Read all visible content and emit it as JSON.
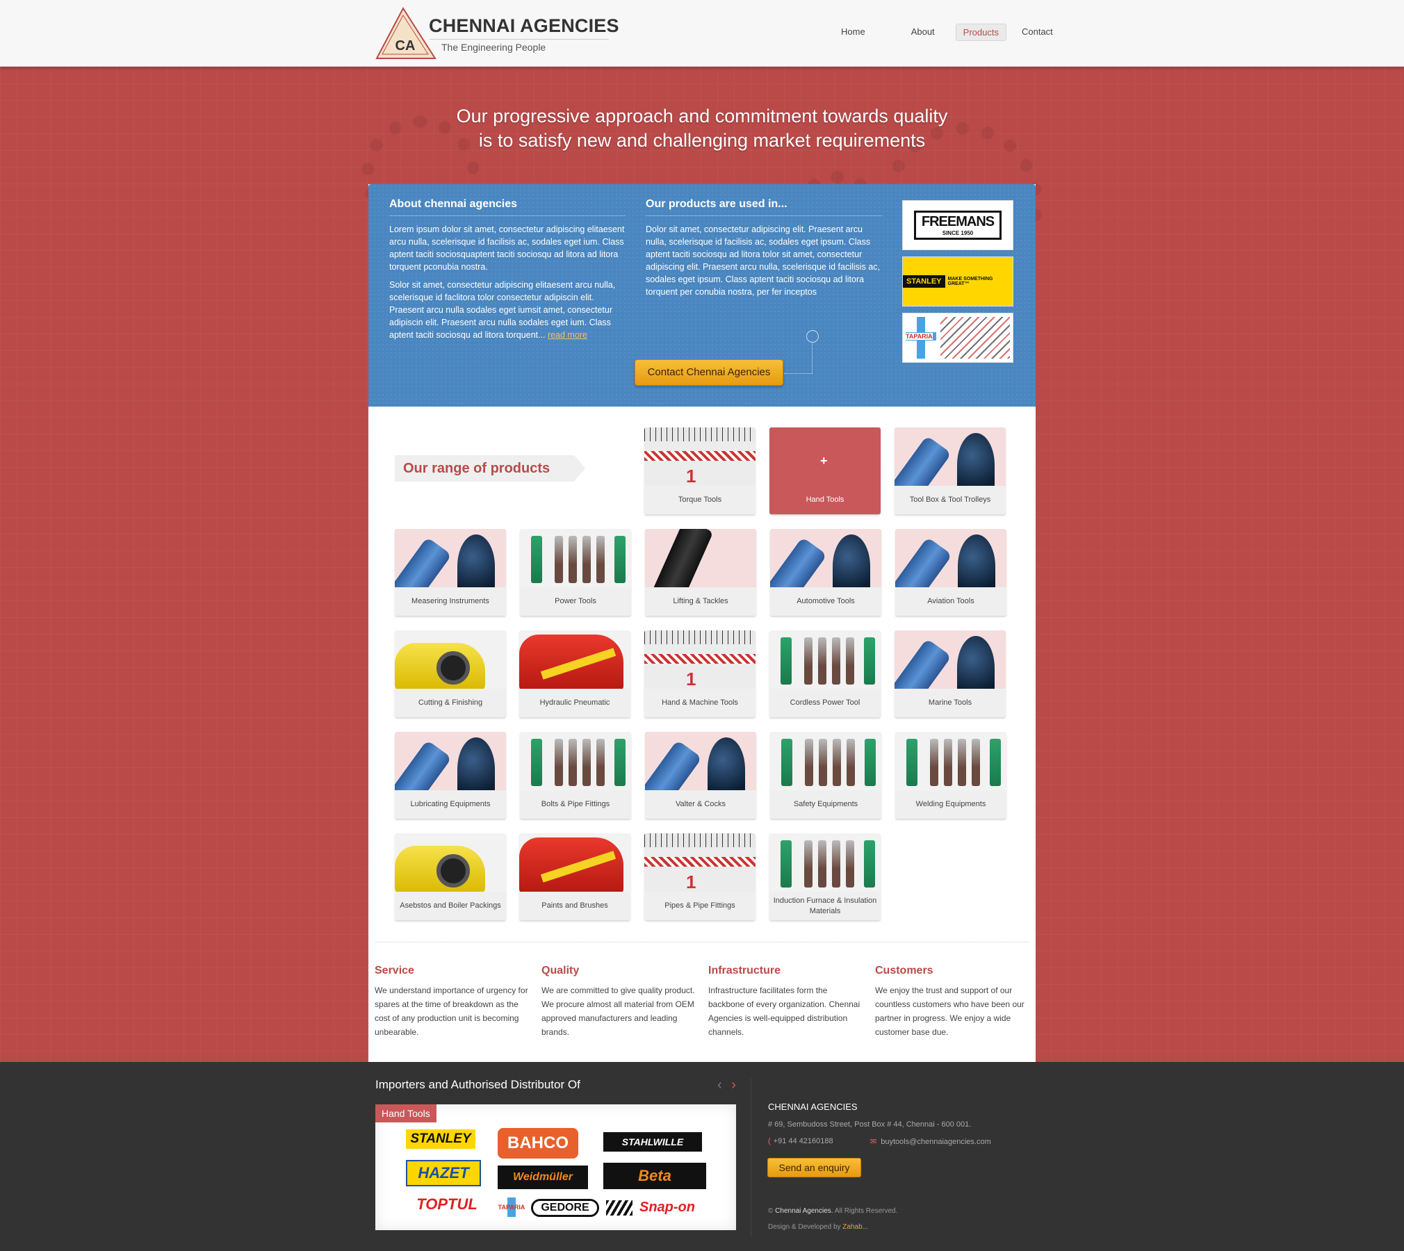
{
  "brand": {
    "name": "CHENNAI AGENCIES",
    "tagline": "The Engineering People",
    "initials": "CA"
  },
  "nav": [
    "Home",
    "About",
    "Products",
    "Contact"
  ],
  "hero": {
    "line1": "Our progressive approach and commitment towards quality",
    "line2": "is to satisfy new and challenging market requirements"
  },
  "about": {
    "title": "About chennai agencies",
    "p1": "Lorem ipsum dolor sit amet, consectetur adipiscing elitaesent arcu nulla, scelerisque id facilisis ac, sodales eget ium. Class aptent taciti sociosquaptent taciti sociosqu ad litora  ad litora torquent pconubia nostra.",
    "p2": "Solor sit amet, consectetur adipiscing elitaesent arcu nulla, scelerisque id faclitora tolor  consectetur adipiscin elit. Praesent arcu nulla sodales eget iumsit amet, consectetur adipiscin elit. Praesent arcu nulla sodales eget ium. Class aptent taciti sociosqu ad litora torquent...",
    "read_more": "read more"
  },
  "used_in": {
    "title": "Our products are used in...",
    "p": "Dolor sit amet, consectetur adipiscing elit. Praesent arcu nulla, scelerisque id facilisis ac, sodales eget ipsum. Class aptent taciti sociosqu ad litora tolor sit amet, consectetur adipiscing elit. Praesent arcu nulla, scelerisque id facilisis ac, sodales eget ipsum. Class aptent taciti sociosqu ad litora torquent per conubia nostra, per fer inceptos"
  },
  "brand_logos": {
    "freemans": "FREEMANS",
    "freemans_since": "SINCE 1950",
    "stanley": "STANLEY",
    "stanley_tag": "MAKE SOMETHING GREAT™",
    "taparia": "TAPARIA"
  },
  "contact_button": "Contact Chennai Agencies",
  "range_title": "Our range of products",
  "products": [
    "Torque Tools",
    "Hand Tools",
    "Tool Box & Tool Trolleys",
    "Measering Instruments",
    "Power Tools",
    "Lifting & Tackles",
    "Automotive Tools",
    "Aviation Tools",
    "Cutting & Finishing",
    "Hydraulic Pneumatic",
    "Hand & Machine Tools",
    "Cordless Power Tool",
    "Marine Tools",
    "Lubricating Equipments",
    "Bolts & Pipe Fittings",
    "Valter & Cocks",
    "Safety Equipments",
    "Welding Equipments",
    "Asebstos and Boiler Packings",
    "Paints and Brushes",
    "Pipes & Pipe Fittings",
    "Induction Furnace & Insulation Materials"
  ],
  "hover_plus": "+",
  "features": [
    {
      "title": "Service",
      "text": "We understand importance of urgency for spares at the time of breakdown as the cost of any production unit is becoming unbearable."
    },
    {
      "title": "Quality",
      "text": "We are committed to give quality product. We procure almost all material from OEM approved manufacturers and leading brands."
    },
    {
      "title": "Infrastructure",
      "text": "Infrastructure facilitates form the backbone of every organization. Chennai Agencies is well-equipped distribution channels."
    },
    {
      "title": "Customers",
      "text": "We enjoy the trust and support of our countless customers who have been our partner in progress. We enjoy a wide customer base due."
    }
  ],
  "footer": {
    "distributor_title": "Importers and Authorised Distributor Of",
    "tab": "Hand Tools",
    "logos": [
      "STANLEY",
      "BAHCO",
      "STAHLWILLE",
      "HAZET",
      "Weidmüller",
      "Beta",
      "TOPTUL",
      "TAPARIA",
      "GEDORE",
      "Snap-on"
    ],
    "arrow_prev": "‹",
    "arrow_next": "›",
    "company": "CHENNAI AGENCIES",
    "address": "# 69, Sembudoss Street,  Post Box # 44,  Chennai - 600 001.",
    "phone": "+91 44 42160188",
    "email": "buytools@chennaiagencies.com",
    "enquiry_button": "Send an enquiry",
    "copyright_prefix": "©",
    "copyright_brand": "Chennai Agencies.",
    "copyright_rest": "All Rights Reserved.",
    "dev_prefix": "Design & Developed by",
    "dev_name": "Zahab..."
  }
}
